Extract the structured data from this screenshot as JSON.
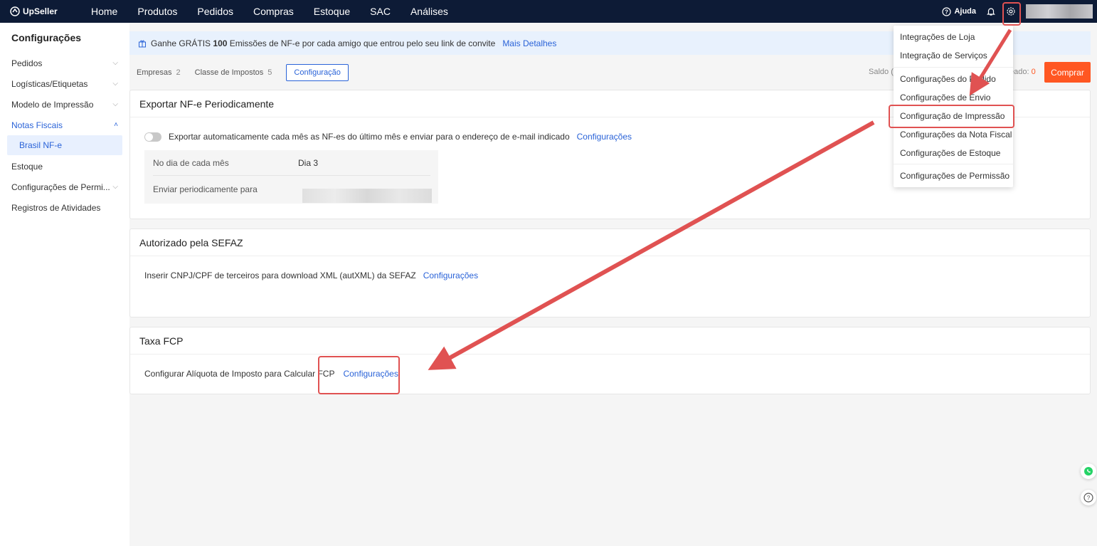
{
  "topbar": {
    "logo": "UpSeller",
    "nav": [
      "Home",
      "Produtos",
      "Pedidos",
      "Compras",
      "Estoque",
      "SAC",
      "Análises"
    ],
    "help": "Ajuda"
  },
  "sidebar": {
    "title": "Configurações",
    "items": [
      {
        "label": "Pedidos",
        "chevron": "down"
      },
      {
        "label": "Logísticas/Etiquetas",
        "chevron": "down"
      },
      {
        "label": "Modelo de Impressão",
        "chevron": "down"
      },
      {
        "label": "Notas Fiscais",
        "chevron": "up",
        "active": true
      },
      {
        "label": "Brasil NF-e",
        "sub": true
      },
      {
        "label": "Estoque",
        "chevron": ""
      },
      {
        "label": "Configurações de Permi...",
        "chevron": "down"
      },
      {
        "label": "Registros de Atividades",
        "chevron": ""
      }
    ]
  },
  "banner": {
    "text_before": "Ganhe GRÁTIS",
    "bold": "100",
    "text_after": "Emissões de NF-e por cada amigo que entrou pelo seu link de convite",
    "link": "Mais Detalhes"
  },
  "tabs": [
    {
      "label": "Empresas",
      "count": "2"
    },
    {
      "label": "Classe de Impostos",
      "count": "5"
    },
    {
      "label": "Configuração",
      "count": ""
    }
  ],
  "balance": {
    "saldo_label": "Saldo (",
    "used_label": "eado:",
    "used_value": "0",
    "buy_button": "Comprar"
  },
  "card_export": {
    "title": "Exportar NF-e Periodicamente",
    "toggle_text": "Exportar automaticamente cada mês as NF-es do último mês e enviar para o endereço de e-mail indicado",
    "link": "Configurações",
    "day_label": "No dia de cada mês",
    "day_value": "Dia 3",
    "send_label": "Enviar periodicamente para"
  },
  "card_sefaz": {
    "title": "Autorizado pela SEFAZ",
    "text": "Inserir CNPJ/CPF de terceiros para download XML (autXML) da SEFAZ",
    "link": "Configurações"
  },
  "card_fcp": {
    "title": "Taxa FCP",
    "text": "Configurar Alíquota de Imposto para Calcular FCP",
    "link": "Configurações"
  },
  "dropdown": {
    "items": [
      "Integrações de Loja",
      "Integração de Serviços",
      "Configurações do Pedido",
      "Configurações de Envio",
      "Configuração de Impressão",
      "Configurações da Nota Fiscal",
      "Configurações de Estoque",
      "Configurações de Permissão"
    ]
  },
  "colors": {
    "topbar": "#0d1b36",
    "accent": "#2a63d8",
    "buy": "#ff5722",
    "annotation": "#e05252"
  }
}
